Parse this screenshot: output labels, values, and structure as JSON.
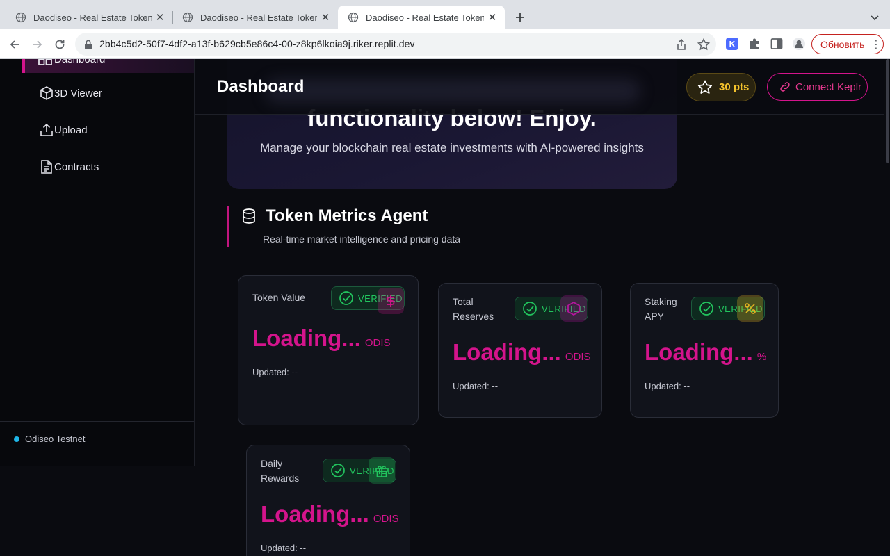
{
  "browser": {
    "tabs": [
      {
        "title": "Daodiseo - Real Estate Tokeniz",
        "active": false
      },
      {
        "title": "Daodiseo - Real Estate Tokeniz",
        "active": false
      },
      {
        "title": "Daodiseo - Real Estate Tokeniz",
        "active": true
      }
    ],
    "url": "2bb4c5d2-50f7-4df2-a13f-b629cb5e86c4-00-z8kp6lkoia9j.riker.replit.dev",
    "update_button": "Обновить"
  },
  "sidebar": {
    "active_item": "Dashboard",
    "items": [
      {
        "label": "3D Viewer",
        "icon": "cube-icon"
      },
      {
        "label": "Upload",
        "icon": "upload-icon"
      },
      {
        "label": "Contracts",
        "icon": "document-icon"
      }
    ],
    "network": "Odiseo Testnet"
  },
  "header": {
    "title": "Dashboard",
    "points": "30 pts",
    "connect_label": "Connect Keplr"
  },
  "hero": {
    "title": "functionality below! Enjoy.",
    "subtitle": "Manage your blockchain real estate investments with AI-powered insights"
  },
  "section": {
    "title": "Token Metrics Agent",
    "subtitle": "Real-time market intelligence and pricing data"
  },
  "cards": [
    {
      "label": "Token Value",
      "badge": "VERIFIED",
      "value": "Loading...",
      "unit": "ODIS",
      "updated": "Updated: --",
      "icon": "dollar-icon",
      "icon_color": "#d4148c"
    },
    {
      "label": "Total Reserves",
      "badge": "VERIFIED",
      "value": "Loading...",
      "unit": "ODIS",
      "updated": "Updated: --",
      "icon": "hexagon-icon",
      "icon_color": "#b5179e"
    },
    {
      "label": "Staking APY",
      "badge": "VERIFIED",
      "value": "Loading...",
      "unit": "%",
      "updated": "Updated: --",
      "icon": "percent-icon",
      "icon_color": "#e0b020"
    },
    {
      "label": "Daily Rewards",
      "badge": "VERIFIED",
      "value": "Loading...",
      "unit": "ODIS",
      "updated": "Updated: --",
      "icon": "gift-icon",
      "icon_color": "#22c55e"
    }
  ],
  "colors": {
    "accent": "#d4148c",
    "verified": "#22c55e",
    "points": "#f5c32c",
    "network_dot": "#1fb6e8"
  }
}
